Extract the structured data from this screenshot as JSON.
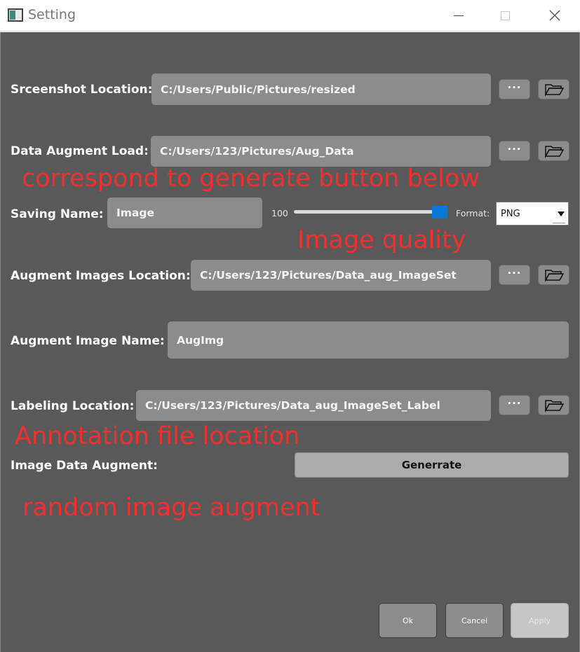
{
  "window": {
    "title": "Setting",
    "icons": {
      "app": "app-icon",
      "minimize": "minimize-icon",
      "maximize": "maximize-icon",
      "close": "close-icon"
    }
  },
  "screenshot_location": {
    "label": "Srceenshot Location:",
    "value": "C:/Users/Public/Pictures/resized"
  },
  "data_augment_load": {
    "label": "Data Augment Load:",
    "value": "C:/Users/123/Pictures/Aug_Data"
  },
  "saving_name": {
    "label": "Saving Name:",
    "value": "Image",
    "quality_label": "100",
    "quality_value": 100,
    "format_label": "Format:",
    "format_value": "PNG"
  },
  "augment_images_location": {
    "label": "Augment Images Location:",
    "value": "C:/Users/123/Pictures/Data_aug_ImageSet"
  },
  "augment_image_name": {
    "label": "Augment Image Name:",
    "value": "AugImg"
  },
  "labeling_location": {
    "label": "Labeling Location:",
    "value": "C:/Users/123/Pictures/Data_aug_ImageSet_Label"
  },
  "image_data_augment": {
    "label": "Image Data Augment:",
    "button": "Generrate"
  },
  "browse_button_label": "···",
  "annotations": {
    "generate_note": "correspond to generate button below",
    "quality_note": "Image quality",
    "label_note": "Annotation file location",
    "augment_note": "random image augment"
  },
  "footer": {
    "ok": "Ok",
    "cancel": "Cancel",
    "apply": "Apply"
  },
  "colors": {
    "background": "#595959",
    "field": "#8c8c8c",
    "annotation": "#f22f2f",
    "slider_handle": "#0a78d7"
  }
}
